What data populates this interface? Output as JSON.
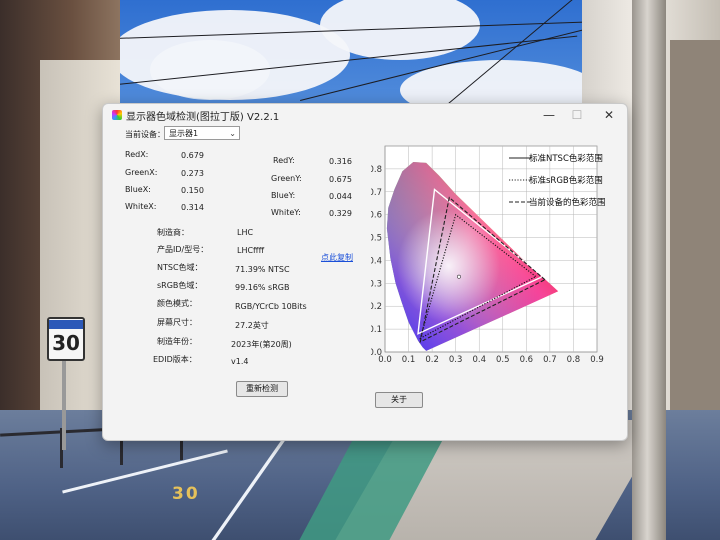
{
  "window": {
    "title": "显示器色域检测(图拉丁版) V2.2.1",
    "controls": {
      "minimize": "—",
      "maximize": "☐",
      "close": "✕"
    }
  },
  "device": {
    "label": "当前设备：",
    "selected": "显示器1"
  },
  "coords": {
    "red_x": {
      "label": "RedX:",
      "value": "0.679"
    },
    "green_x": {
      "label": "GreenX:",
      "value": "0.273"
    },
    "blue_x": {
      "label": "BlueX:",
      "value": "0.150"
    },
    "white_x": {
      "label": "WhiteX:",
      "value": "0.314"
    },
    "red_y": {
      "label": "RedY:",
      "value": "0.316"
    },
    "green_y": {
      "label": "GreenY:",
      "value": "0.675"
    },
    "blue_y": {
      "label": "BlueY:",
      "value": "0.044"
    },
    "white_y": {
      "label": "WhiteY:",
      "value": "0.329"
    }
  },
  "info": [
    {
      "label": "制造商：",
      "value": "LHC"
    },
    {
      "label": "产品ID/型号：",
      "value": "LHCffff"
    },
    {
      "label": "NTSC色域：",
      "value": "71.39% NTSC"
    },
    {
      "label": "sRGB色域：",
      "value": "99.16% sRGB"
    },
    {
      "label": "颜色模式：",
      "value": "RGB/YCrCb 10Bits"
    },
    {
      "label": "屏幕尺寸：",
      "value": "27.2英寸"
    },
    {
      "label": "制造年份：",
      "value": "2023年(第20周)"
    },
    {
      "label": "EDID版本：",
      "value": "v1.4"
    }
  ],
  "copy_link": "点此复制",
  "buttons": {
    "redetect": "重新检测",
    "about": "关于"
  },
  "chart_data": {
    "type": "scatter",
    "title": "",
    "xlabel": "",
    "ylabel": "",
    "xlim": [
      0,
      0.9
    ],
    "ylim": [
      0,
      0.9
    ],
    "x_ticks": [
      "0.0",
      "0.1",
      "0.2",
      "0.3",
      "0.4",
      "0.5",
      "0.6",
      "0.7",
      "0.8",
      "0.9"
    ],
    "y_ticks": [
      "0.0",
      "0.1",
      "0.2",
      "0.3",
      "0.4",
      "0.5",
      "0.6",
      "0.7",
      "0.8",
      "0.9"
    ],
    "grid": true,
    "legend_placement": "top-right",
    "series": [
      {
        "name": "标准NTSC色彩范围",
        "style": "solid",
        "points": [
          [
            0.67,
            0.33
          ],
          [
            0.21,
            0.71
          ],
          [
            0.14,
            0.08
          ]
        ]
      },
      {
        "name": "标准sRGB色彩范围",
        "style": "dotted",
        "points": [
          [
            0.64,
            0.33
          ],
          [
            0.3,
            0.6
          ],
          [
            0.15,
            0.06
          ]
        ]
      },
      {
        "name": "当前设备的色彩范围",
        "style": "dashed",
        "points": [
          [
            0.679,
            0.316
          ],
          [
            0.273,
            0.675
          ],
          [
            0.15,
            0.044
          ]
        ]
      }
    ],
    "white_point": [
      0.314,
      0.329
    ]
  },
  "colors": {
    "link": "#1a4fd8",
    "window_bg": "#f3f3f3"
  }
}
